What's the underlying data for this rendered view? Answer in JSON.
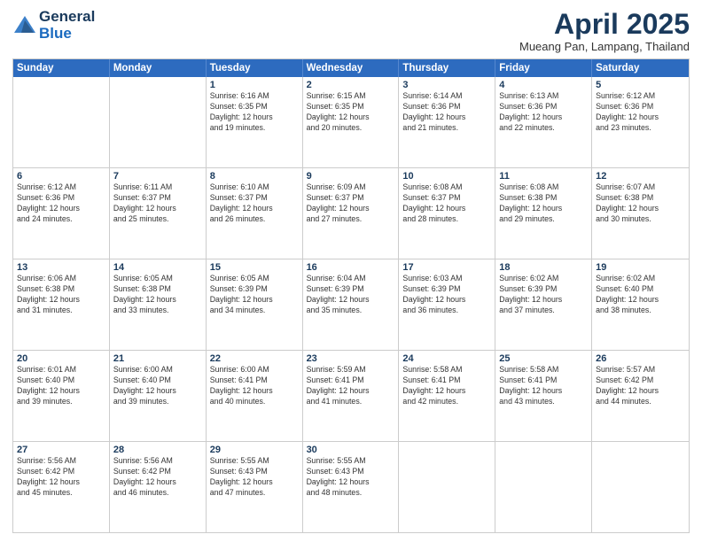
{
  "header": {
    "logo_general": "General",
    "logo_blue": "Blue",
    "month_title": "April 2025",
    "location": "Mueang Pan, Lampang, Thailand"
  },
  "weekdays": [
    "Sunday",
    "Monday",
    "Tuesday",
    "Wednesday",
    "Thursday",
    "Friday",
    "Saturday"
  ],
  "rows": [
    [
      {
        "day": "",
        "lines": []
      },
      {
        "day": "",
        "lines": []
      },
      {
        "day": "1",
        "lines": [
          "Sunrise: 6:16 AM",
          "Sunset: 6:35 PM",
          "Daylight: 12 hours",
          "and 19 minutes."
        ]
      },
      {
        "day": "2",
        "lines": [
          "Sunrise: 6:15 AM",
          "Sunset: 6:35 PM",
          "Daylight: 12 hours",
          "and 20 minutes."
        ]
      },
      {
        "day": "3",
        "lines": [
          "Sunrise: 6:14 AM",
          "Sunset: 6:36 PM",
          "Daylight: 12 hours",
          "and 21 minutes."
        ]
      },
      {
        "day": "4",
        "lines": [
          "Sunrise: 6:13 AM",
          "Sunset: 6:36 PM",
          "Daylight: 12 hours",
          "and 22 minutes."
        ]
      },
      {
        "day": "5",
        "lines": [
          "Sunrise: 6:12 AM",
          "Sunset: 6:36 PM",
          "Daylight: 12 hours",
          "and 23 minutes."
        ]
      }
    ],
    [
      {
        "day": "6",
        "lines": [
          "Sunrise: 6:12 AM",
          "Sunset: 6:36 PM",
          "Daylight: 12 hours",
          "and 24 minutes."
        ]
      },
      {
        "day": "7",
        "lines": [
          "Sunrise: 6:11 AM",
          "Sunset: 6:37 PM",
          "Daylight: 12 hours",
          "and 25 minutes."
        ]
      },
      {
        "day": "8",
        "lines": [
          "Sunrise: 6:10 AM",
          "Sunset: 6:37 PM",
          "Daylight: 12 hours",
          "and 26 minutes."
        ]
      },
      {
        "day": "9",
        "lines": [
          "Sunrise: 6:09 AM",
          "Sunset: 6:37 PM",
          "Daylight: 12 hours",
          "and 27 minutes."
        ]
      },
      {
        "day": "10",
        "lines": [
          "Sunrise: 6:08 AM",
          "Sunset: 6:37 PM",
          "Daylight: 12 hours",
          "and 28 minutes."
        ]
      },
      {
        "day": "11",
        "lines": [
          "Sunrise: 6:08 AM",
          "Sunset: 6:38 PM",
          "Daylight: 12 hours",
          "and 29 minutes."
        ]
      },
      {
        "day": "12",
        "lines": [
          "Sunrise: 6:07 AM",
          "Sunset: 6:38 PM",
          "Daylight: 12 hours",
          "and 30 minutes."
        ]
      }
    ],
    [
      {
        "day": "13",
        "lines": [
          "Sunrise: 6:06 AM",
          "Sunset: 6:38 PM",
          "Daylight: 12 hours",
          "and 31 minutes."
        ]
      },
      {
        "day": "14",
        "lines": [
          "Sunrise: 6:05 AM",
          "Sunset: 6:38 PM",
          "Daylight: 12 hours",
          "and 33 minutes."
        ]
      },
      {
        "day": "15",
        "lines": [
          "Sunrise: 6:05 AM",
          "Sunset: 6:39 PM",
          "Daylight: 12 hours",
          "and 34 minutes."
        ]
      },
      {
        "day": "16",
        "lines": [
          "Sunrise: 6:04 AM",
          "Sunset: 6:39 PM",
          "Daylight: 12 hours",
          "and 35 minutes."
        ]
      },
      {
        "day": "17",
        "lines": [
          "Sunrise: 6:03 AM",
          "Sunset: 6:39 PM",
          "Daylight: 12 hours",
          "and 36 minutes."
        ]
      },
      {
        "day": "18",
        "lines": [
          "Sunrise: 6:02 AM",
          "Sunset: 6:39 PM",
          "Daylight: 12 hours",
          "and 37 minutes."
        ]
      },
      {
        "day": "19",
        "lines": [
          "Sunrise: 6:02 AM",
          "Sunset: 6:40 PM",
          "Daylight: 12 hours",
          "and 38 minutes."
        ]
      }
    ],
    [
      {
        "day": "20",
        "lines": [
          "Sunrise: 6:01 AM",
          "Sunset: 6:40 PM",
          "Daylight: 12 hours",
          "and 39 minutes."
        ]
      },
      {
        "day": "21",
        "lines": [
          "Sunrise: 6:00 AM",
          "Sunset: 6:40 PM",
          "Daylight: 12 hours",
          "and 39 minutes."
        ]
      },
      {
        "day": "22",
        "lines": [
          "Sunrise: 6:00 AM",
          "Sunset: 6:41 PM",
          "Daylight: 12 hours",
          "and 40 minutes."
        ]
      },
      {
        "day": "23",
        "lines": [
          "Sunrise: 5:59 AM",
          "Sunset: 6:41 PM",
          "Daylight: 12 hours",
          "and 41 minutes."
        ]
      },
      {
        "day": "24",
        "lines": [
          "Sunrise: 5:58 AM",
          "Sunset: 6:41 PM",
          "Daylight: 12 hours",
          "and 42 minutes."
        ]
      },
      {
        "day": "25",
        "lines": [
          "Sunrise: 5:58 AM",
          "Sunset: 6:41 PM",
          "Daylight: 12 hours",
          "and 43 minutes."
        ]
      },
      {
        "day": "26",
        "lines": [
          "Sunrise: 5:57 AM",
          "Sunset: 6:42 PM",
          "Daylight: 12 hours",
          "and 44 minutes."
        ]
      }
    ],
    [
      {
        "day": "27",
        "lines": [
          "Sunrise: 5:56 AM",
          "Sunset: 6:42 PM",
          "Daylight: 12 hours",
          "and 45 minutes."
        ]
      },
      {
        "day": "28",
        "lines": [
          "Sunrise: 5:56 AM",
          "Sunset: 6:42 PM",
          "Daylight: 12 hours",
          "and 46 minutes."
        ]
      },
      {
        "day": "29",
        "lines": [
          "Sunrise: 5:55 AM",
          "Sunset: 6:43 PM",
          "Daylight: 12 hours",
          "and 47 minutes."
        ]
      },
      {
        "day": "30",
        "lines": [
          "Sunrise: 5:55 AM",
          "Sunset: 6:43 PM",
          "Daylight: 12 hours",
          "and 48 minutes."
        ]
      },
      {
        "day": "",
        "lines": []
      },
      {
        "day": "",
        "lines": []
      },
      {
        "day": "",
        "lines": []
      }
    ]
  ]
}
